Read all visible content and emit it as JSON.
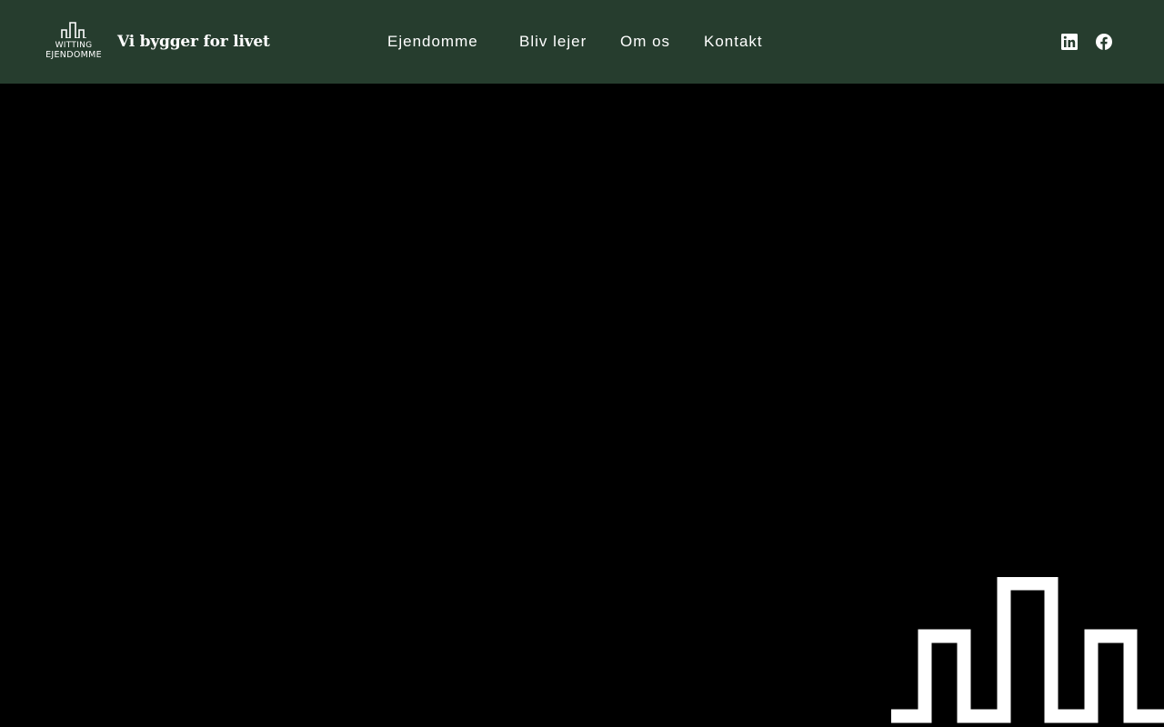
{
  "brand": {
    "logo_line1": "WITTING",
    "logo_line2": "EJENDOMME",
    "tagline": "Vi bygger for livet"
  },
  "nav": {
    "items": [
      {
        "label": "Ejendomme"
      },
      {
        "label": "Bliv lejer"
      },
      {
        "label": "Om os"
      },
      {
        "label": "Kontakt"
      }
    ]
  },
  "social": {
    "icons": [
      "linkedin-icon",
      "facebook-icon"
    ]
  },
  "colors": {
    "header_bg": "#263d2e",
    "hero_bg": "#000000",
    "foreground": "#ffffff"
  }
}
